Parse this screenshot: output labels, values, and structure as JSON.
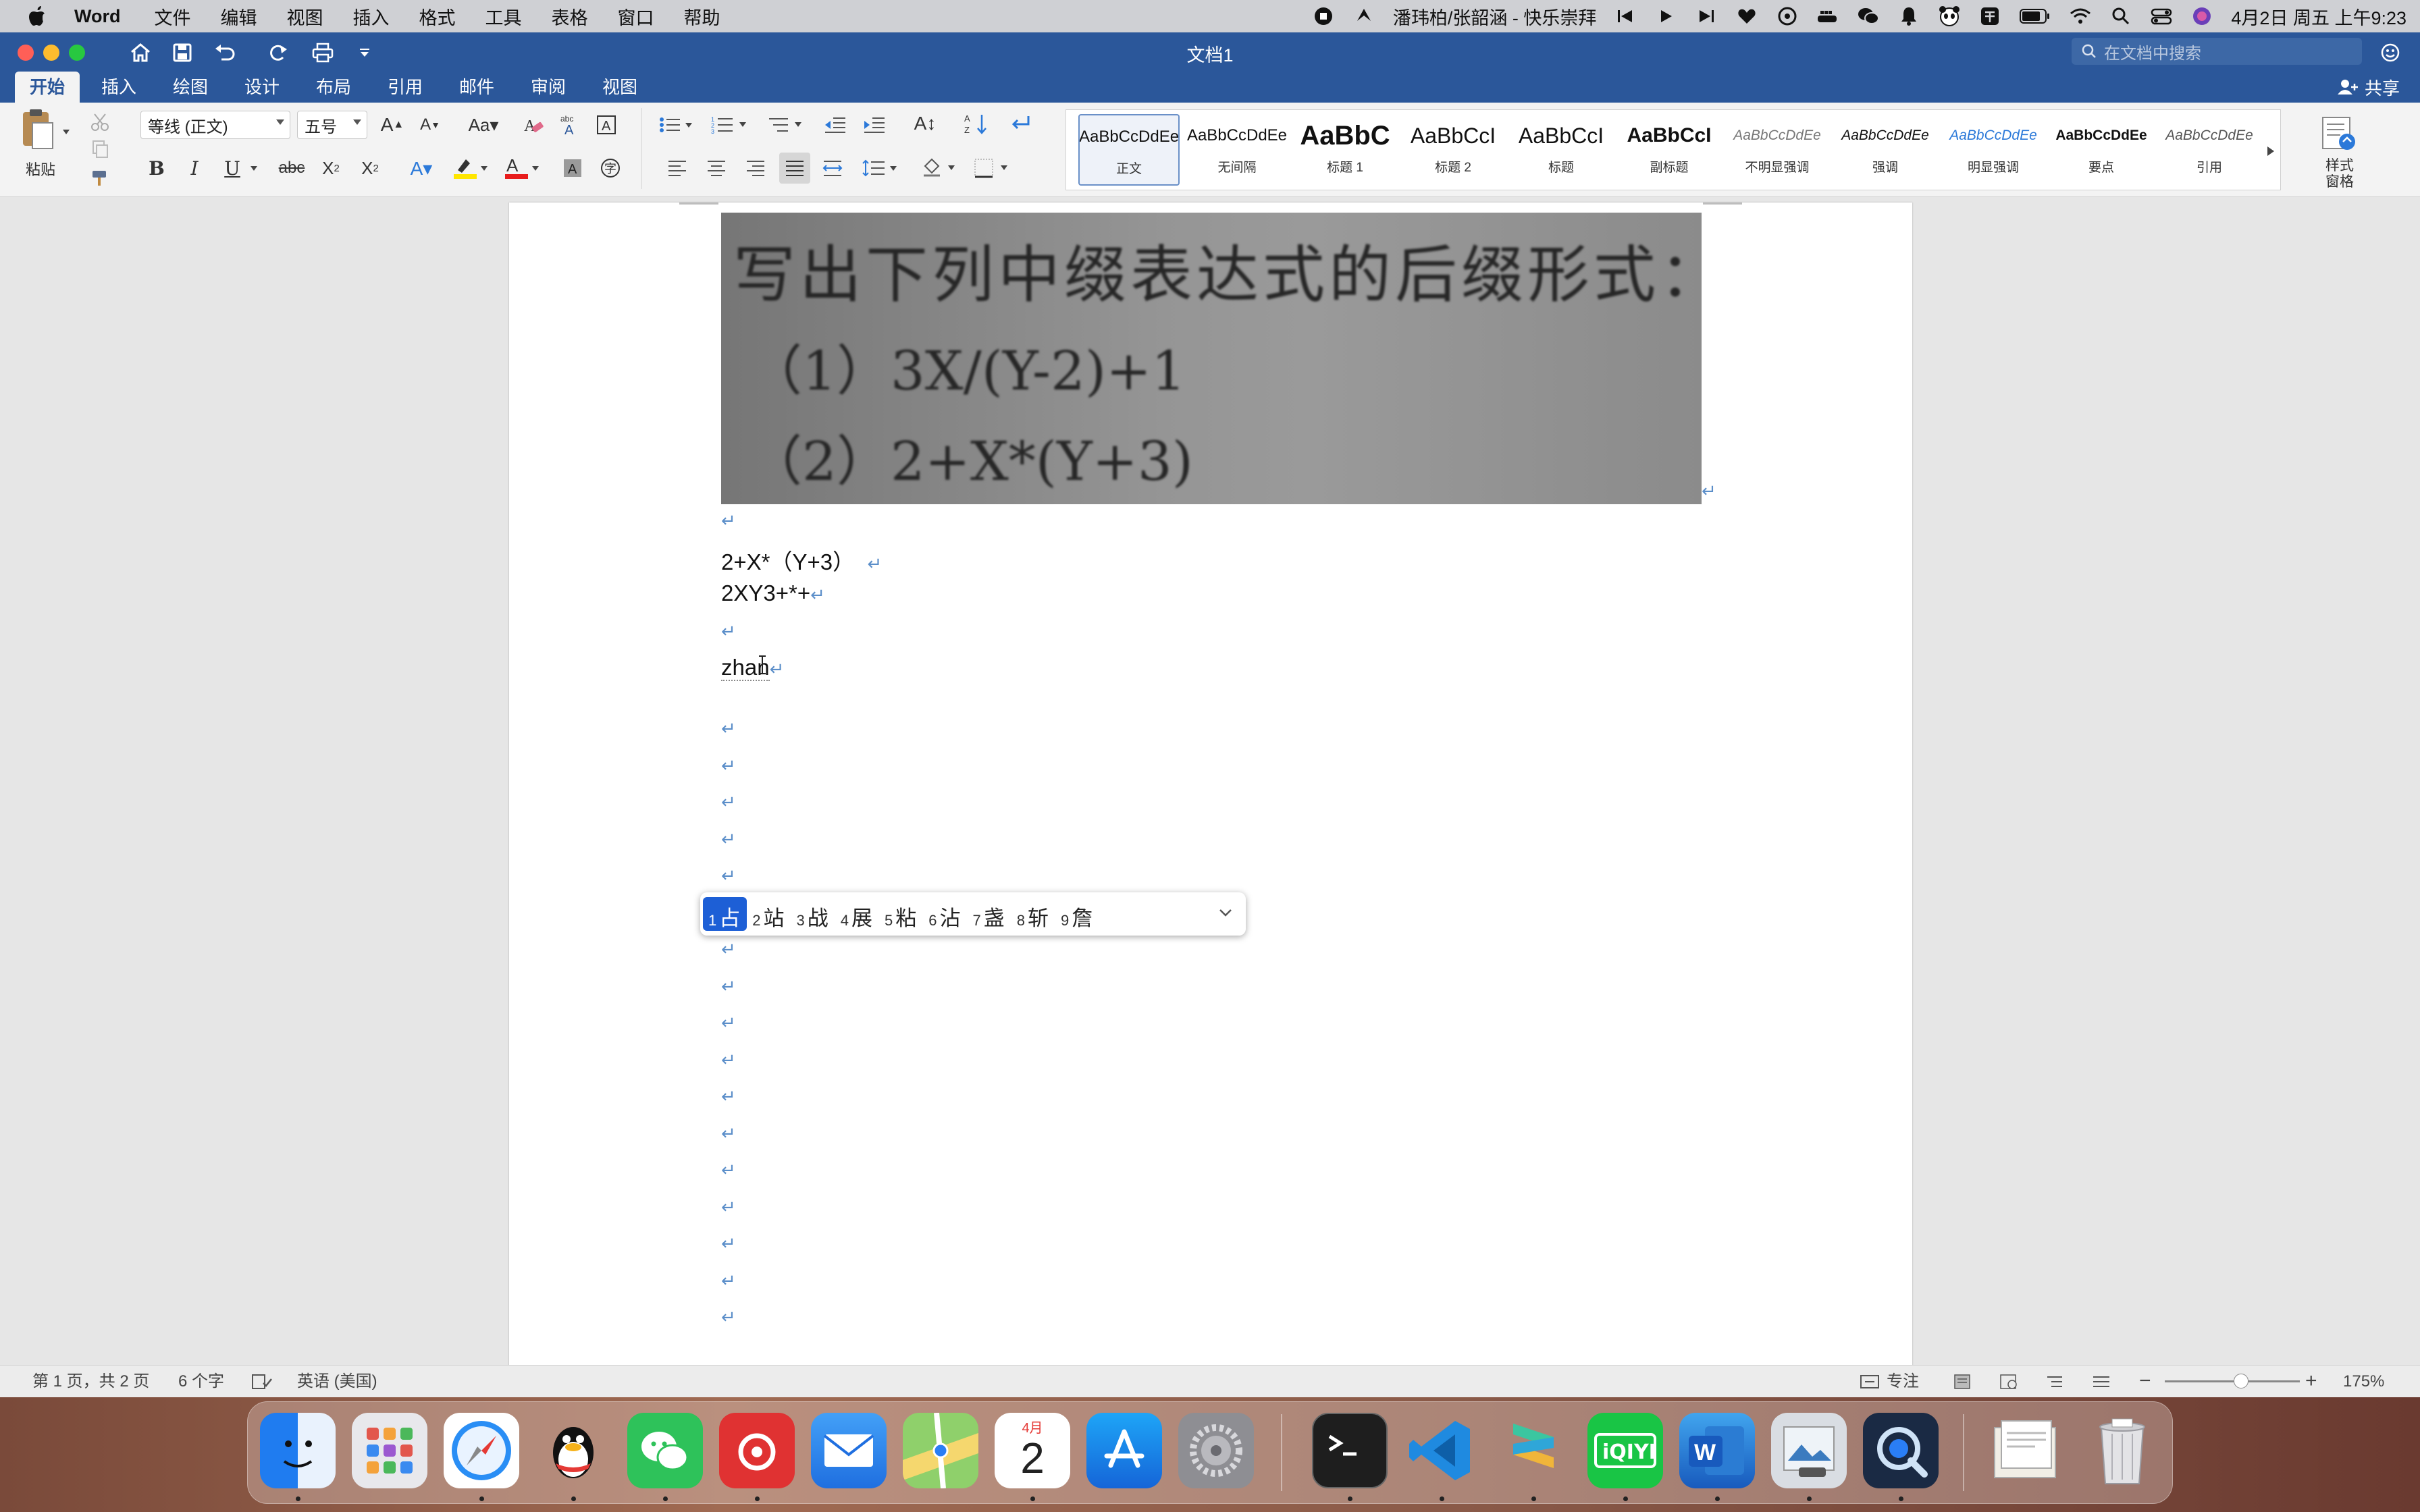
{
  "menubar": {
    "app_name": "Word",
    "items": [
      "文件",
      "编辑",
      "视图",
      "插入",
      "格式",
      "工具",
      "表格",
      "窗口",
      "帮助"
    ],
    "now_playing": "潘玮柏/张韶涵 - 快乐崇拜",
    "datetime": "4月2日 周五 上午9:23"
  },
  "window": {
    "title": "文档1",
    "search_placeholder": "在文档中搜索",
    "share_label": "共享"
  },
  "tabs": [
    "开始",
    "插入",
    "绘图",
    "设计",
    "布局",
    "引用",
    "邮件",
    "审阅",
    "视图"
  ],
  "ribbon": {
    "paste_label": "粘贴",
    "font_name": "等线 (正文)",
    "font_size": "五号",
    "bold": "B",
    "italic": "I",
    "underline": "U",
    "strike": "abc",
    "styles_pane_label": "样式\n窗格",
    "styles": [
      {
        "preview": "AaBbCcDdEe",
        "name": "正文"
      },
      {
        "preview": "AaBbCcDdEe",
        "name": "无间隔"
      },
      {
        "preview": "AaBbC",
        "name": "标题 1"
      },
      {
        "preview": "AaBbCcI",
        "name": "标题 2"
      },
      {
        "preview": "AaBbCcI",
        "name": "标题"
      },
      {
        "preview": "AaBbCcI",
        "name": "副标题"
      },
      {
        "preview": "AaBbCcDdEe",
        "name": "不明显强调"
      },
      {
        "preview": "AaBbCcDdEe",
        "name": "强调"
      },
      {
        "preview": "AaBbCcDdEe",
        "name": "明显强调"
      },
      {
        "preview": "AaBbCcDdEe",
        "name": "要点"
      },
      {
        "preview": "AaBbCcDdEe",
        "name": "引用"
      }
    ]
  },
  "document": {
    "image_text": {
      "line1": "写出下列中缀表达式的后缀形式：",
      "line2": "（1）3X/(Y-2)+1",
      "line3": "（2）2+X*(Y+3)"
    },
    "lines": [
      "2+X*（Y+3）",
      "2XY3+*+",
      "zhan"
    ],
    "paragraph_mark": "↵"
  },
  "ime": {
    "candidates": [
      {
        "n": "1",
        "c": "占"
      },
      {
        "n": "2",
        "c": "站"
      },
      {
        "n": "3",
        "c": "战"
      },
      {
        "n": "4",
        "c": "展"
      },
      {
        "n": "5",
        "c": "粘"
      },
      {
        "n": "6",
        "c": "沾"
      },
      {
        "n": "7",
        "c": "盏"
      },
      {
        "n": "8",
        "c": "斩"
      },
      {
        "n": "9",
        "c": "詹"
      }
    ]
  },
  "statusbar": {
    "page": "第 1 页，共 2 页",
    "words": "6 个字",
    "language": "英语 (美国)",
    "focus": "专注",
    "zoom": "175%"
  },
  "dock": {
    "calendar_month": "4月",
    "calendar_day": "2"
  },
  "colors": {
    "word_blue": "#2b579a",
    "ime_selected": "#1d5fd6",
    "paragraph_mark": "#5b8ec9"
  }
}
